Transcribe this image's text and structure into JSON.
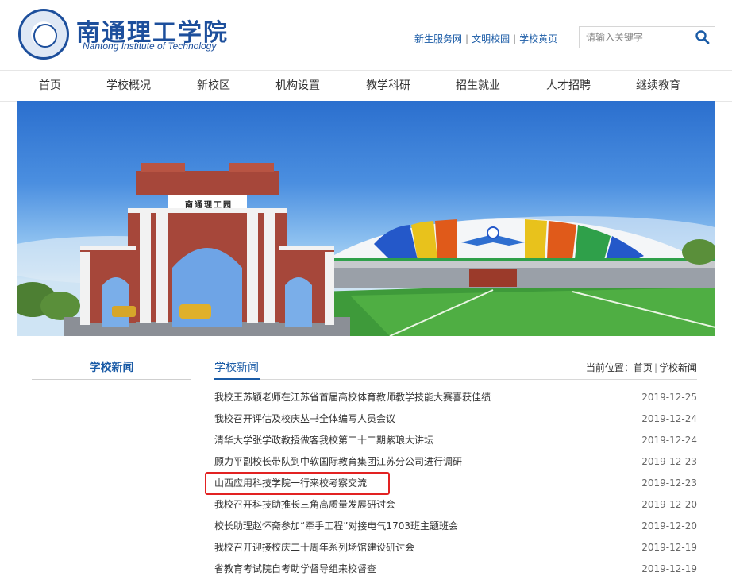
{
  "header": {
    "logo_cn": "南通理工学院",
    "logo_en": "Nantong Institute of Technology",
    "top_links": [
      "新生服务网",
      "文明校园",
      "学校黄页"
    ],
    "search_placeholder": "请输入关键字"
  },
  "nav": {
    "items": [
      "首页",
      "学校概况",
      "新校区",
      "机构设置",
      "教学科研",
      "招生就业",
      "人才招聘",
      "继续教育"
    ]
  },
  "banner": {
    "gate_inscription": "南通理工园"
  },
  "sidebar": {
    "title": "学校新闻"
  },
  "main": {
    "title": "学校新闻",
    "breadcrumb_prefix": "当前位置：",
    "breadcrumb": [
      "首页",
      "学校新闻"
    ],
    "news": [
      {
        "title": "我校王苏颖老师在江苏省首届高校体育教师教学技能大赛喜获佳绩",
        "date": "2019-12-25"
      },
      {
        "title": "我校召开评估及校庆丛书全体编写人员会议",
        "date": "2019-12-24"
      },
      {
        "title": "清华大学张学政教授做客我校第二十二期紫琅大讲坛",
        "date": "2019-12-24"
      },
      {
        "title": "顾力平副校长带队到中软国际教育集团江苏分公司进行调研",
        "date": "2019-12-23"
      },
      {
        "title": "山西应用科技学院一行来校考察交流",
        "date": "2019-12-23"
      },
      {
        "title": "我校召开科技助推长三角高质量发展研讨会",
        "date": "2019-12-20"
      },
      {
        "title": "校长助理赵怀斋参加“牵手工程”对接电气1703班主题班会",
        "date": "2019-12-20"
      },
      {
        "title": "我校召开迎接校庆二十周年系列场馆建设研讨会",
        "date": "2019-12-19"
      },
      {
        "title": "省教育考试院自考助学督导组来校督查",
        "date": "2019-12-19"
      }
    ]
  },
  "colors": {
    "brand_blue": "#1d4f9c",
    "link_blue": "#1a5ba6",
    "highlight_red": "#e22222"
  }
}
